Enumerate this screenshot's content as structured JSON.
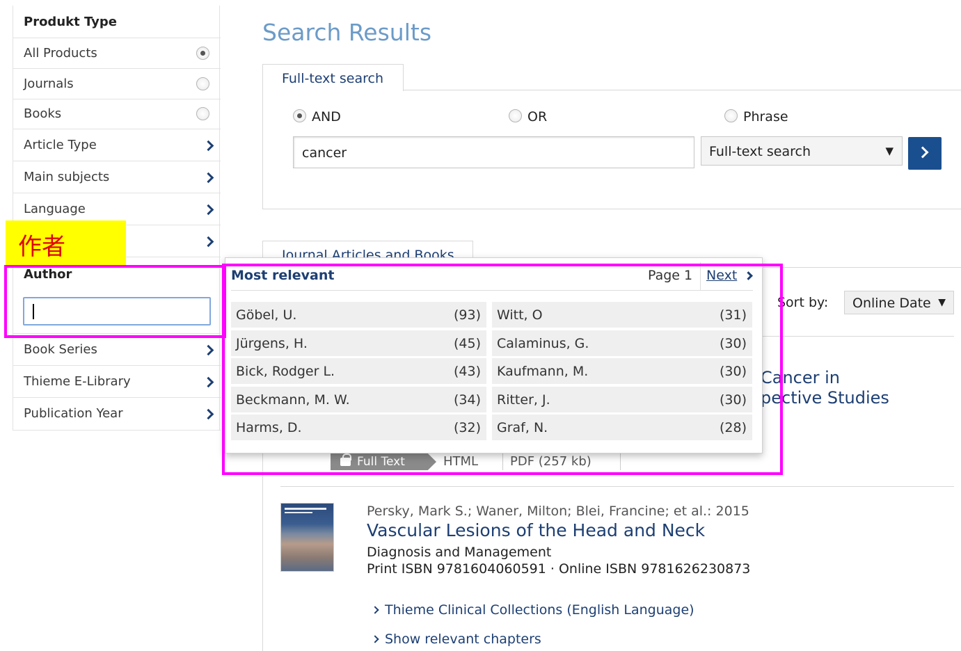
{
  "sidebar": {
    "product_type": {
      "heading": "Produkt Type",
      "options": [
        {
          "label": "All Products",
          "selected": true
        },
        {
          "label": "Journals",
          "selected": false
        },
        {
          "label": "Books",
          "selected": false
        }
      ]
    },
    "filters_top": [
      "Article Type",
      "Main subjects",
      "Language"
    ],
    "author": {
      "heading": "Author",
      "input_value": ""
    },
    "filters_bottom": [
      "Book Series",
      "Thieme E-Library",
      "Publication Year"
    ]
  },
  "annotation": {
    "label": "作者",
    "color": "#ff00ff",
    "label_bg": "#ffff00"
  },
  "main": {
    "title": "Search Results",
    "search": {
      "tab": "Full-text search",
      "modes": [
        {
          "label": "AND",
          "selected": true
        },
        {
          "label": "OR",
          "selected": false
        },
        {
          "label": "Phrase",
          "selected": false
        }
      ],
      "query": "cancer",
      "scope": "Full-text search"
    },
    "results_tab": "Journal Articles and Books",
    "sort": {
      "label": "Sort by:",
      "value": "Online Date"
    },
    "first_result": {
      "title_line1": "Cancer in",
      "title_line2": "pective Studies",
      "actions": {
        "full_text": "Full Text",
        "html": "HTML",
        "pdf": "PDF (257 kb)"
      }
    },
    "second_result": {
      "authors": "Persky, Mark S.; Waner, Milton; Blei, Francine; et al.: 2015",
      "title": "Vascular Lesions of the Head and Neck",
      "subtitle": "Diagnosis and Management",
      "isbn": "Print ISBN 9781604060591 · Online ISBN 9781626230873",
      "links": [
        "Thieme Clinical Collections (English Language)",
        "Show relevant chapters"
      ]
    }
  },
  "author_dropdown": {
    "heading": "Most relevant",
    "page_label": "Page 1",
    "next_label": "Next",
    "left": [
      {
        "name": "Göbel, U.",
        "count": "(93)"
      },
      {
        "name": "Jürgens, H.",
        "count": "(45)"
      },
      {
        "name": "Bick, Rodger L.",
        "count": "(43)"
      },
      {
        "name": "Beckmann, M. W.",
        "count": "(34)"
      },
      {
        "name": "Harms, D.",
        "count": "(32)"
      }
    ],
    "right": [
      {
        "name": "Witt, O",
        "count": "(31)"
      },
      {
        "name": "Calaminus, G.",
        "count": "(30)"
      },
      {
        "name": "Kaufmann, M.",
        "count": "(30)"
      },
      {
        "name": "Ritter, J.",
        "count": "(30)"
      },
      {
        "name": "Graf, N.",
        "count": "(28)"
      }
    ]
  },
  "colors": {
    "accent": "#1d3f73",
    "title": "#6b9bc8",
    "button": "#1a4f8f"
  }
}
